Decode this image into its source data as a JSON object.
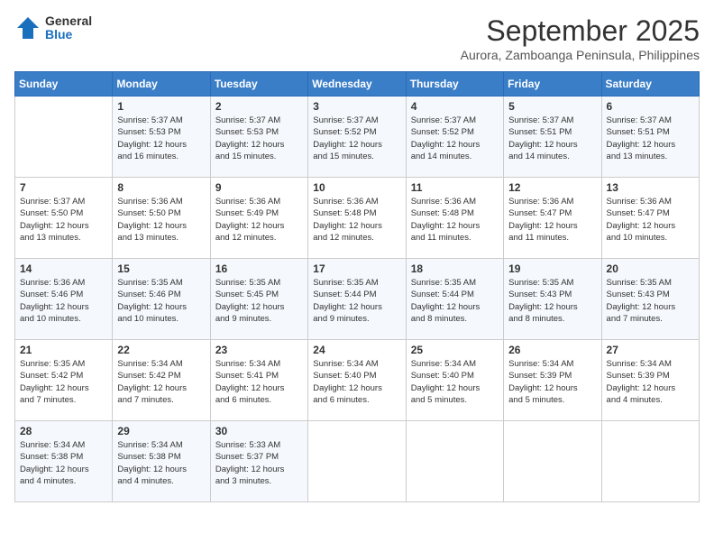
{
  "logo": {
    "general": "General",
    "blue": "Blue"
  },
  "title": {
    "month_year": "September 2025",
    "location": "Aurora, Zamboanga Peninsula, Philippines"
  },
  "days_header": [
    "Sunday",
    "Monday",
    "Tuesday",
    "Wednesday",
    "Thursday",
    "Friday",
    "Saturday"
  ],
  "weeks": [
    [
      {
        "day": "",
        "info": ""
      },
      {
        "day": "1",
        "info": "Sunrise: 5:37 AM\nSunset: 5:53 PM\nDaylight: 12 hours\nand 16 minutes."
      },
      {
        "day": "2",
        "info": "Sunrise: 5:37 AM\nSunset: 5:53 PM\nDaylight: 12 hours\nand 15 minutes."
      },
      {
        "day": "3",
        "info": "Sunrise: 5:37 AM\nSunset: 5:52 PM\nDaylight: 12 hours\nand 15 minutes."
      },
      {
        "day": "4",
        "info": "Sunrise: 5:37 AM\nSunset: 5:52 PM\nDaylight: 12 hours\nand 14 minutes."
      },
      {
        "day": "5",
        "info": "Sunrise: 5:37 AM\nSunset: 5:51 PM\nDaylight: 12 hours\nand 14 minutes."
      },
      {
        "day": "6",
        "info": "Sunrise: 5:37 AM\nSunset: 5:51 PM\nDaylight: 12 hours\nand 13 minutes."
      }
    ],
    [
      {
        "day": "7",
        "info": "Sunrise: 5:37 AM\nSunset: 5:50 PM\nDaylight: 12 hours\nand 13 minutes."
      },
      {
        "day": "8",
        "info": "Sunrise: 5:36 AM\nSunset: 5:50 PM\nDaylight: 12 hours\nand 13 minutes."
      },
      {
        "day": "9",
        "info": "Sunrise: 5:36 AM\nSunset: 5:49 PM\nDaylight: 12 hours\nand 12 minutes."
      },
      {
        "day": "10",
        "info": "Sunrise: 5:36 AM\nSunset: 5:48 PM\nDaylight: 12 hours\nand 12 minutes."
      },
      {
        "day": "11",
        "info": "Sunrise: 5:36 AM\nSunset: 5:48 PM\nDaylight: 12 hours\nand 11 minutes."
      },
      {
        "day": "12",
        "info": "Sunrise: 5:36 AM\nSunset: 5:47 PM\nDaylight: 12 hours\nand 11 minutes."
      },
      {
        "day": "13",
        "info": "Sunrise: 5:36 AM\nSunset: 5:47 PM\nDaylight: 12 hours\nand 10 minutes."
      }
    ],
    [
      {
        "day": "14",
        "info": "Sunrise: 5:36 AM\nSunset: 5:46 PM\nDaylight: 12 hours\nand 10 minutes."
      },
      {
        "day": "15",
        "info": "Sunrise: 5:35 AM\nSunset: 5:46 PM\nDaylight: 12 hours\nand 10 minutes."
      },
      {
        "day": "16",
        "info": "Sunrise: 5:35 AM\nSunset: 5:45 PM\nDaylight: 12 hours\nand 9 minutes."
      },
      {
        "day": "17",
        "info": "Sunrise: 5:35 AM\nSunset: 5:44 PM\nDaylight: 12 hours\nand 9 minutes."
      },
      {
        "day": "18",
        "info": "Sunrise: 5:35 AM\nSunset: 5:44 PM\nDaylight: 12 hours\nand 8 minutes."
      },
      {
        "day": "19",
        "info": "Sunrise: 5:35 AM\nSunset: 5:43 PM\nDaylight: 12 hours\nand 8 minutes."
      },
      {
        "day": "20",
        "info": "Sunrise: 5:35 AM\nSunset: 5:43 PM\nDaylight: 12 hours\nand 7 minutes."
      }
    ],
    [
      {
        "day": "21",
        "info": "Sunrise: 5:35 AM\nSunset: 5:42 PM\nDaylight: 12 hours\nand 7 minutes."
      },
      {
        "day": "22",
        "info": "Sunrise: 5:34 AM\nSunset: 5:42 PM\nDaylight: 12 hours\nand 7 minutes."
      },
      {
        "day": "23",
        "info": "Sunrise: 5:34 AM\nSunset: 5:41 PM\nDaylight: 12 hours\nand 6 minutes."
      },
      {
        "day": "24",
        "info": "Sunrise: 5:34 AM\nSunset: 5:40 PM\nDaylight: 12 hours\nand 6 minutes."
      },
      {
        "day": "25",
        "info": "Sunrise: 5:34 AM\nSunset: 5:40 PM\nDaylight: 12 hours\nand 5 minutes."
      },
      {
        "day": "26",
        "info": "Sunrise: 5:34 AM\nSunset: 5:39 PM\nDaylight: 12 hours\nand 5 minutes."
      },
      {
        "day": "27",
        "info": "Sunrise: 5:34 AM\nSunset: 5:39 PM\nDaylight: 12 hours\nand 4 minutes."
      }
    ],
    [
      {
        "day": "28",
        "info": "Sunrise: 5:34 AM\nSunset: 5:38 PM\nDaylight: 12 hours\nand 4 minutes."
      },
      {
        "day": "29",
        "info": "Sunrise: 5:34 AM\nSunset: 5:38 PM\nDaylight: 12 hours\nand 4 minutes."
      },
      {
        "day": "30",
        "info": "Sunrise: 5:33 AM\nSunset: 5:37 PM\nDaylight: 12 hours\nand 3 minutes."
      },
      {
        "day": "",
        "info": ""
      },
      {
        "day": "",
        "info": ""
      },
      {
        "day": "",
        "info": ""
      },
      {
        "day": "",
        "info": ""
      }
    ]
  ]
}
